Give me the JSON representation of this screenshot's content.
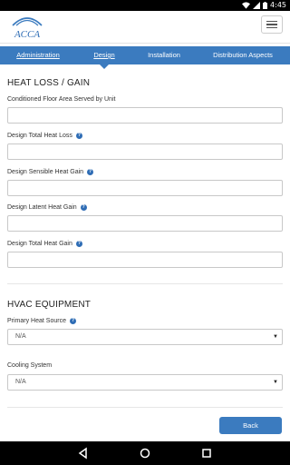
{
  "status_bar": {
    "time": "4:45"
  },
  "header": {
    "logo_text": "ACCA"
  },
  "tabs": [
    {
      "label": "Administration"
    },
    {
      "label": "Design"
    },
    {
      "label": "Installation"
    },
    {
      "label": "Distribution Aspects"
    }
  ],
  "heat_section": {
    "title": "HEAT LOSS / GAIN",
    "fields": [
      {
        "label": "Conditioned Floor Area Served by Unit",
        "value": ""
      },
      {
        "label": "Design Total Heat Loss",
        "value": ""
      },
      {
        "label": "Design Sensible Heat Gain",
        "value": ""
      },
      {
        "label": "Design Latent Heat Gain",
        "value": ""
      },
      {
        "label": "Design Total Heat Gain",
        "value": ""
      }
    ]
  },
  "equipment_section": {
    "title": "HVAC EQUIPMENT",
    "primary_heat_source": {
      "label": "Primary Heat Source",
      "value": "N/A"
    },
    "cooling_system": {
      "label": "Cooling System",
      "value": "N/A"
    }
  },
  "footer": {
    "back_label": "Back"
  },
  "icons": {
    "help": "question-circle-icon",
    "dropdown": "caret-down-icon",
    "menu": "hamburger-menu-icon"
  },
  "colors": {
    "accent": "#3b7bbf",
    "help_icon": "#2f6db5"
  }
}
